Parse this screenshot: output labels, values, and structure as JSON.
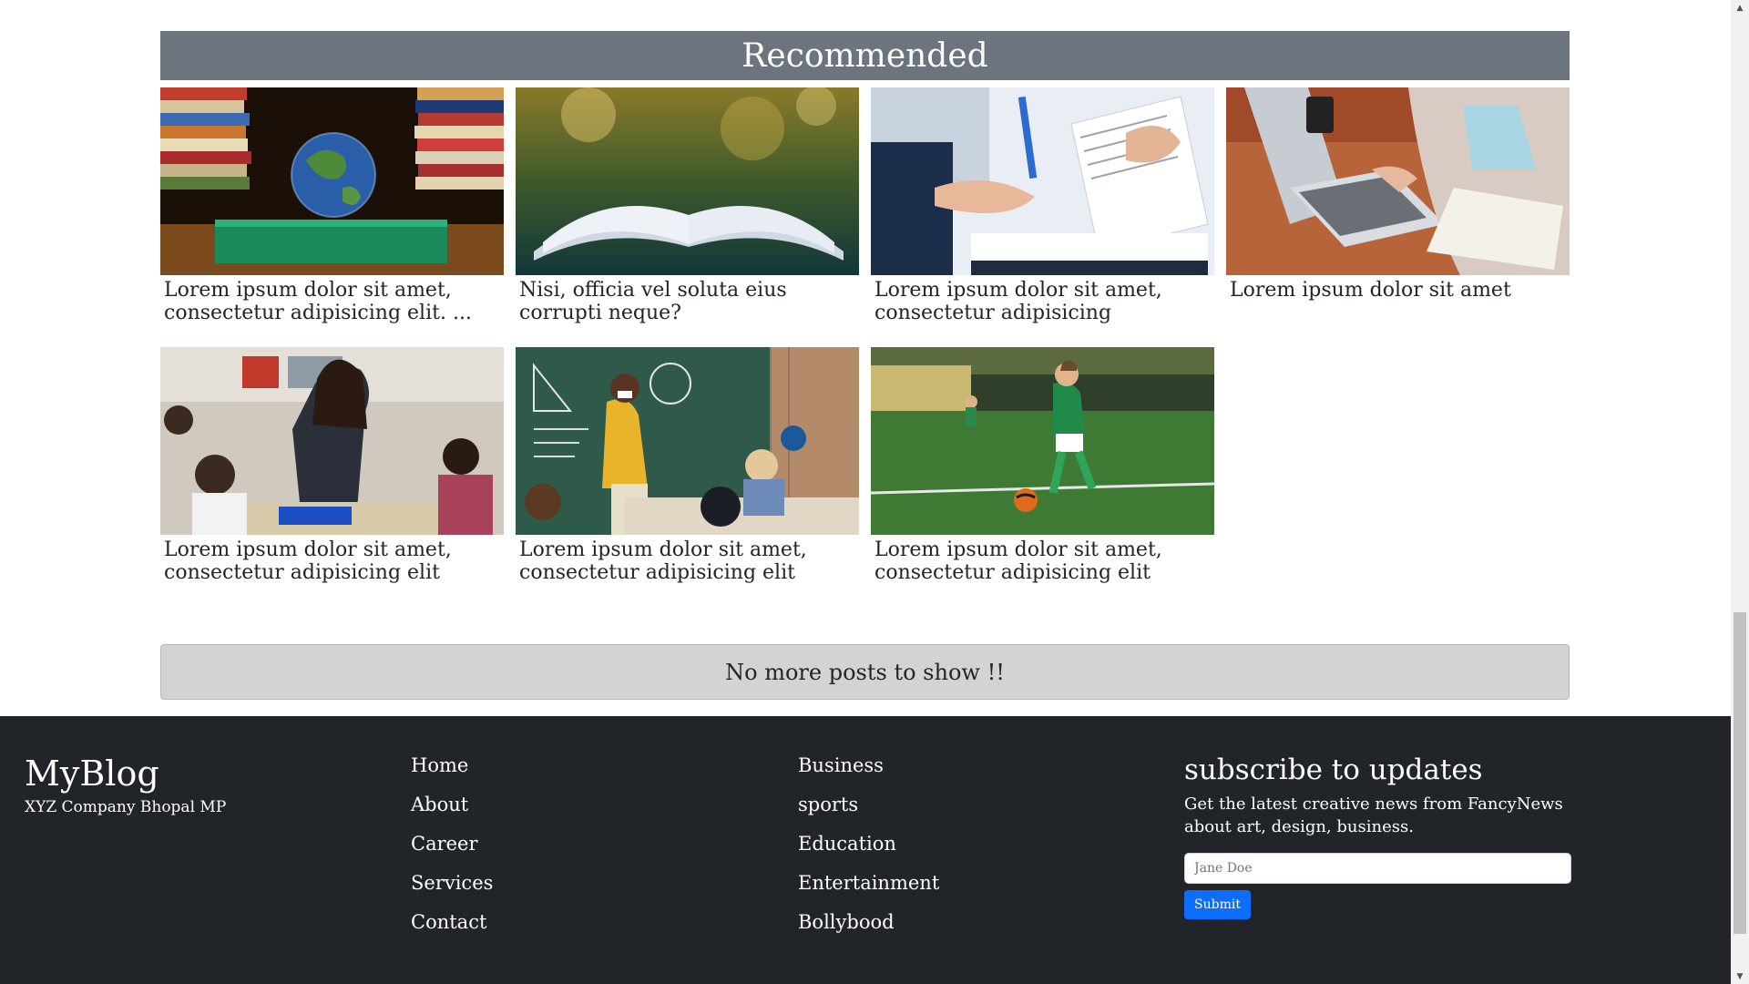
{
  "recommended": {
    "heading": "Recommended",
    "posts": [
      {
        "title": "Lorem ipsum dolor sit amet, consectetur adipisicing elit. ...",
        "image": "education-globe-books"
      },
      {
        "title": "Nisi, officia vel soluta eius corrupti neque?",
        "image": "open-book-nature"
      },
      {
        "title": "Lorem ipsum dolor sit amet, consectetur adipisicing",
        "image": "business-documents-pen"
      },
      {
        "title": "Lorem ipsum dolor sit amet",
        "image": "laptop-typing"
      },
      {
        "title": "Lorem ipsum dolor sit amet, consectetur adipisicing elit",
        "image": "teacher-classroom"
      },
      {
        "title": "Lorem ipsum dolor sit amet, consectetur adipisicing elit",
        "image": "teacher-mask-blackboard"
      },
      {
        "title": "Lorem ipsum dolor sit amet, consectetur adipisicing elit",
        "image": "boy-soccer"
      }
    ],
    "no_more": "No more posts to show !!"
  },
  "footer": {
    "brand": "MyBlog",
    "address": "XYZ Company Bhopal MP",
    "links_col1": [
      "Home",
      "About",
      "Career",
      "Services",
      "Contact"
    ],
    "links_col2": [
      "Business",
      "sports",
      "Education",
      "Entertainment",
      "Bollybood"
    ],
    "subscribe": {
      "title": "subscribe to updates",
      "description": "Get the latest creative news from FancyNews about art, design, business.",
      "placeholder": "Jane Doe",
      "button": "Submit"
    }
  },
  "colors": {
    "header_bg": "#6c757d",
    "footer_bg": "#212529",
    "button_bg": "#0d6efd",
    "no_more_bg": "#d3d3d3"
  }
}
